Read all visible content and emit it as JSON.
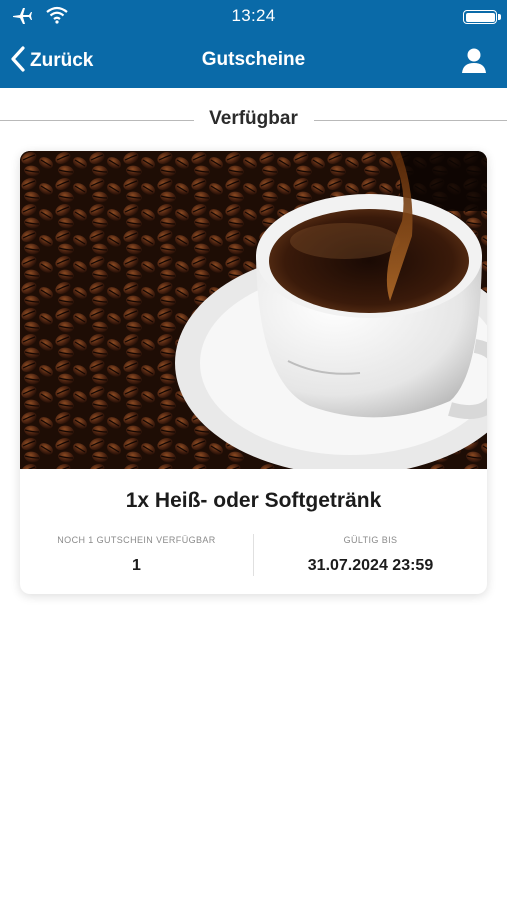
{
  "statusbar": {
    "time": "13:24",
    "icons": [
      "airplane-icon",
      "wifi-icon",
      "battery-icon"
    ]
  },
  "navbar": {
    "back_label": "Zurück",
    "title": "Gutscheine",
    "profile_icon": "user-icon"
  },
  "section": {
    "title": "Verfügbar"
  },
  "voucher": {
    "image": "coffee-cup-with-beans",
    "title": "1x Heiß- oder Softgetränk",
    "remaining_label": "NOCH 1 GUTSCHEIN VERFÜGBAR",
    "remaining_value": "1",
    "valid_label": "GÜLTIG BIS",
    "valid_value": "31.07.2024 23:59"
  },
  "colors": {
    "brand": "#0a6aa8",
    "background": "#ffffff",
    "divider": "#b9b9b9"
  }
}
